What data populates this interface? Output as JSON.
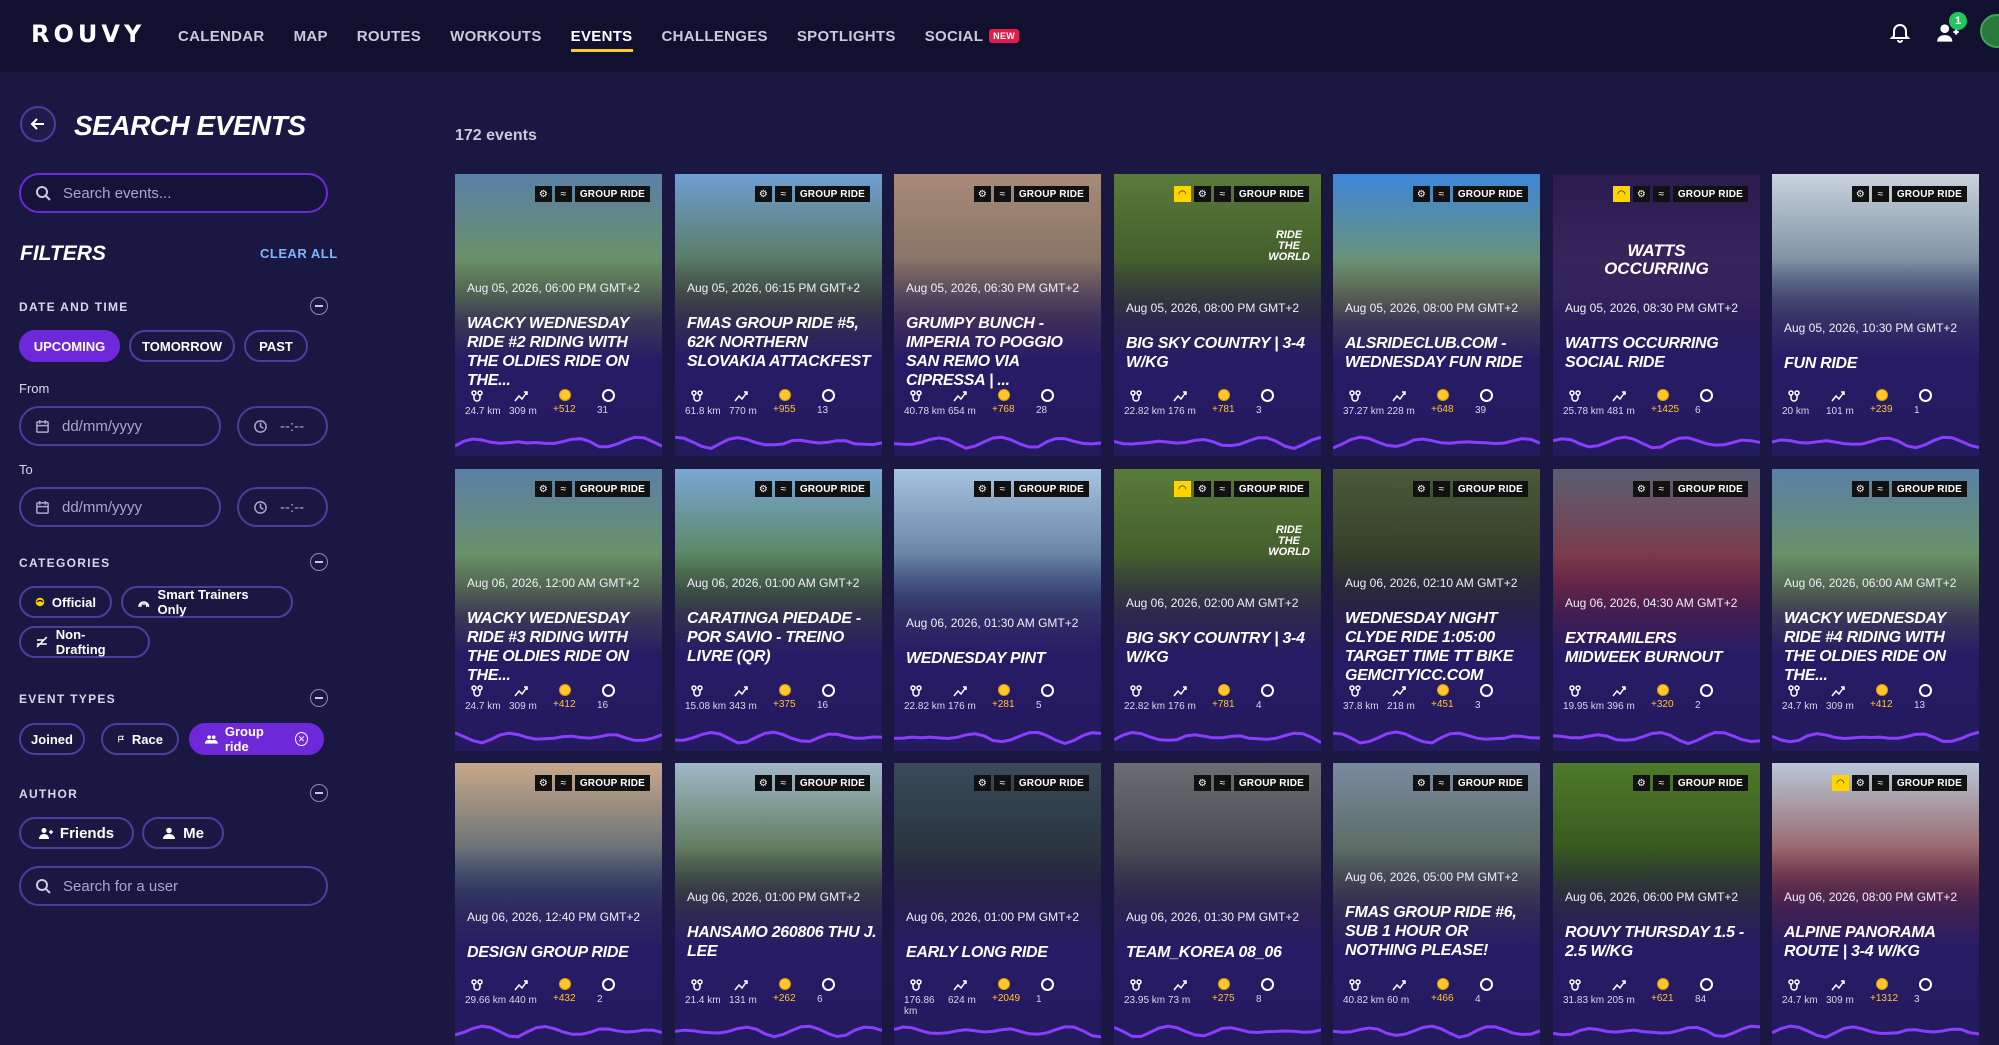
{
  "nav": {
    "logo": "ROUVY",
    "items": [
      "CALENDAR",
      "MAP",
      "ROUTES",
      "WORKOUTS",
      "EVENTS",
      "CHALLENGES",
      "SPOTLIGHTS",
      "SOCIAL"
    ],
    "active": "EVENTS",
    "new_badge": "NEW",
    "friends_count": "1"
  },
  "sidebar": {
    "title": "SEARCH EVENTS",
    "search_placeholder": "Search events...",
    "filters_title": "FILTERS",
    "clear_all": "CLEAR ALL",
    "date_time_label": "DATE AND TIME",
    "date_chips": [
      "UPCOMING",
      "TOMORROW",
      "PAST"
    ],
    "from_label": "From",
    "to_label": "To",
    "date_placeholder": "dd/mm/yyyy",
    "time_placeholder": "--:--",
    "categories_label": "CATEGORIES",
    "categories": [
      "Official",
      "Smart Trainers Only",
      "Non-Drafting"
    ],
    "event_types_label": "EVENT TYPES",
    "event_types": [
      "Joined",
      "Race",
      "Group ride"
    ],
    "author_label": "AUTHOR",
    "authors": [
      "Friends",
      "Me"
    ],
    "user_search_placeholder": "Search for a user"
  },
  "events_count": "172 events",
  "tag_label": "GROUP RIDE",
  "events": [
    {
      "date": "Aug 05, 2026, 06:00 PM GMT+2",
      "title": "WACKY WEDNESDAY RIDE #2 RIDING WITH THE OLDIES RIDE ON THE...",
      "distance": "24.7 km",
      "elevation": "309 m",
      "xp": "+512",
      "riders": "31",
      "official": false,
      "bg": "#5b7fa8",
      "bg2": "#6f9a4a"
    },
    {
      "date": "Aug 05, 2026, 06:15 PM GMT+2",
      "title": "FMAS GROUP RIDE #5, 62K NORTHERN SLOVAKIA ATTACKFEST",
      "distance": "61.8 km",
      "elevation": "770 m",
      "xp": "+955",
      "riders": "13",
      "official": false,
      "bg": "#6f9ed2",
      "bg2": "#4f6b33"
    },
    {
      "date": "Aug 05, 2026, 06:30 PM GMT+2",
      "title": "GRUMPY BUNCH - IMPERIA TO POGGIO SAN REMO VIA CIPRESSA | ...",
      "distance": "40.78 km",
      "elevation": "654 m",
      "xp": "+768",
      "riders": "28",
      "official": false,
      "bg": "#a88a78",
      "bg2": "#7a6a5e"
    },
    {
      "date": "Aug 05, 2026, 08:00 PM GMT+2",
      "title": "BIG SKY COUNTRY | 3-4 W/KG",
      "distance": "22.82 km",
      "elevation": "176 m",
      "xp": "+781",
      "riders": "3",
      "official": true,
      "bg": "#5a7a3a",
      "bg2": "#3b5226",
      "watermark": "RIDE THE WORLD"
    },
    {
      "date": "Aug 05, 2026, 08:00 PM GMT+2",
      "title": "ALSRIDECLUB.COM - WEDNESDAY FUN RIDE",
      "distance": "37.27 km",
      "elevation": "228 m",
      "xp": "+648",
      "riders": "39",
      "official": false,
      "bg": "#3d86d9",
      "bg2": "#7e9a48"
    },
    {
      "date": "Aug 05, 2026, 08:30 PM GMT+2",
      "title": "WATTS OCCURRING SOCIAL RIDE",
      "distance": "25.78 km",
      "elevation": "481 m",
      "xp": "+1425",
      "riders": "6",
      "official": true,
      "bg": "#2b1b4f",
      "bg2": "#3a2a60",
      "watermark": "WATTS OCCURRING"
    },
    {
      "date": "Aug 05, 2026, 10:30 PM GMT+2",
      "title": "FUN RIDE",
      "distance": "20 km",
      "elevation": "101 m",
      "xp": "+239",
      "riders": "1",
      "official": false,
      "bg": "#c9d3dc",
      "bg2": "#5d7389"
    },
    {
      "date": "Aug 06, 2026, 12:00 AM GMT+2",
      "title": "WACKY WEDNESDAY RIDE #3 RIDING WITH THE OLDIES RIDE ON THE...",
      "distance": "24.7 km",
      "elevation": "309 m",
      "xp": "+412",
      "riders": "16",
      "official": false,
      "bg": "#5b7fa8",
      "bg2": "#6f9a4a"
    },
    {
      "date": "Aug 06, 2026, 01:00 AM GMT+2",
      "title": "CARATINGA PIEDADE - POR SAVIO - TREINO LIVRE (QR)",
      "distance": "15.08 km",
      "elevation": "343 m",
      "xp": "+375",
      "riders": "16",
      "official": false,
      "bg": "#7aa6d6",
      "bg2": "#4d7a2f"
    },
    {
      "date": "Aug 06, 2026, 01:30 AM GMT+2",
      "title": "WEDNESDAY PINT",
      "distance": "22.82 km",
      "elevation": "176 m",
      "xp": "+281",
      "riders": "5",
      "official": false,
      "bg": "#a6c3e0",
      "bg2": "#4a6a8a"
    },
    {
      "date": "Aug 06, 2026, 02:00 AM GMT+2",
      "title": "BIG SKY COUNTRY | 3-4 W/KG",
      "distance": "22.82 km",
      "elevation": "176 m",
      "xp": "+781",
      "riders": "4",
      "official": true,
      "bg": "#5a7a3a",
      "bg2": "#3b5226",
      "watermark": "RIDE THE WORLD"
    },
    {
      "date": "Aug 06, 2026, 02:10 AM GMT+2",
      "title": "WEDNESDAY NIGHT CLYDE RIDE 1:05:00 TARGET TIME TT BIKE GEMCITYICC.COM",
      "distance": "37.8 km",
      "elevation": "218 m",
      "xp": "+451",
      "riders": "3",
      "official": false,
      "bg": "#4a5a3a",
      "bg2": "#2a3322"
    },
    {
      "date": "Aug 06, 2026, 04:30 AM GMT+2",
      "title": "EXTRAMILERS MIDWEEK BURNOUT",
      "distance": "19.95 km",
      "elevation": "396 m",
      "xp": "+320",
      "riders": "2",
      "official": false,
      "bg": "#5a5f72",
      "bg2": "#8a2a3a"
    },
    {
      "date": "Aug 06, 2026, 06:00 AM GMT+2",
      "title": "WACKY WEDNESDAY RIDE #4 RIDING WITH THE OLDIES RIDE ON THE...",
      "distance": "24.7 km",
      "elevation": "309 m",
      "xp": "+412",
      "riders": "13",
      "official": false,
      "bg": "#5b7fa8",
      "bg2": "#6f9a4a"
    },
    {
      "date": "Aug 06, 2026, 12:40 PM GMT+2",
      "title": "DESIGN GROUP RIDE",
      "distance": "29.66 km",
      "elevation": "440 m",
      "xp": "+432",
      "riders": "2",
      "official": false,
      "bg": "#c8a88a",
      "bg2": "#3d5a6e"
    },
    {
      "date": "Aug 06, 2026, 01:00 PM GMT+2",
      "title": "HANSAMO 260806 THU J. LEE",
      "distance": "21.4 km",
      "elevation": "131 m",
      "xp": "+262",
      "riders": "6",
      "official": false,
      "bg": "#a0b8c8",
      "bg2": "#44602e"
    },
    {
      "date": "Aug 06, 2026, 01:00 PM GMT+2",
      "title": "EARLY LONG RIDE",
      "distance": "176.86 km",
      "elevation": "624 m",
      "xp": "+2049",
      "riders": "1",
      "official": false,
      "bg": "#3a4a5a",
      "bg2": "#222b33"
    },
    {
      "date": "Aug 06, 2026, 01:30 PM GMT+2",
      "title": "TEAM_KOREA 08_06",
      "distance": "23.95 km",
      "elevation": "73 m",
      "xp": "+275",
      "riders": "8",
      "official": false,
      "bg": "#6a6e72",
      "bg2": "#3a3e44"
    },
    {
      "date": "Aug 06, 2026, 05:00 PM GMT+2",
      "title": "FMAS GROUP RIDE #6, SUB 1 HOUR OR NOTHING PLEASE!",
      "distance": "40.82 km",
      "elevation": "60 m",
      "xp": "+466",
      "riders": "4",
      "official": false,
      "bg": "#7a8aa0",
      "bg2": "#4e5e48"
    },
    {
      "date": "Aug 06, 2026, 06:00 PM GMT+2",
      "title": "ROUVY THURSDAY 1.5 - 2.5 W/KG",
      "distance": "31.83 km",
      "elevation": "205 m",
      "xp": "+621",
      "riders": "84",
      "official": false,
      "bg": "#4e7a2a",
      "bg2": "#2e4a1a"
    },
    {
      "date": "Aug 06, 2026, 08:00 PM GMT+2",
      "title": "ALPINE PANORAMA ROUTE | 3-4 W/KG",
      "distance": "24.7 km",
      "elevation": "309 m",
      "xp": "+1312",
      "riders": "3",
      "official": true,
      "bg": "#b8c8d8",
      "bg2": "#8a3a3a"
    }
  ]
}
